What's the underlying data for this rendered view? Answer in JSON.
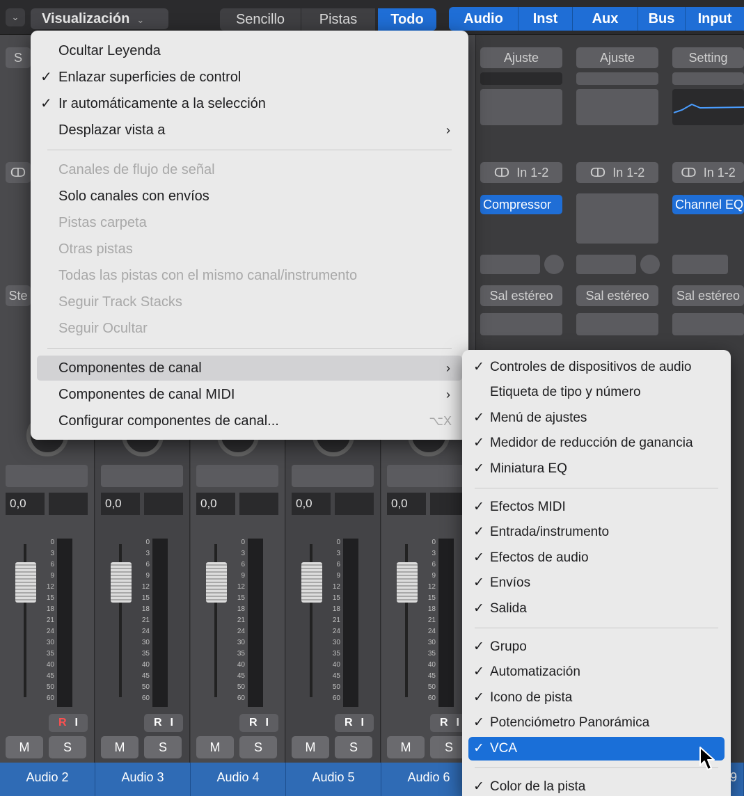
{
  "toolbar": {
    "collapse_icon": "chevron-down-icon",
    "view_menu": "Visualización",
    "filters": [
      "Sencillo",
      "Pistas",
      "Todo"
    ],
    "active_filter": "Todo",
    "types": [
      "Audio",
      "Inst",
      "Aux",
      "Bus",
      "Input"
    ]
  },
  "strip_fragments": {
    "settings_partial": "S",
    "output_partial": "Ste",
    "link_icon": "link-rings-icon"
  },
  "right_strips": [
    {
      "setting": "Ajuste",
      "input": "In 1-2",
      "plugin": "Compressor",
      "output": "Sal estéreo"
    },
    {
      "setting": "Ajuste",
      "input": "In 1-2",
      "plugin": "",
      "output": "Sal estéreo"
    },
    {
      "setting": "Setting",
      "input": "In 1-2",
      "plugin": "Channel EQ",
      "output": "Sal estéreo"
    }
  ],
  "channels": [
    {
      "name": "Audio 2",
      "volume": "0,0"
    },
    {
      "name": "Audio 3",
      "volume": "0,0"
    },
    {
      "name": "Audio 4",
      "volume": "0,0"
    },
    {
      "name": "Audio 5",
      "volume": "0,0"
    },
    {
      "name": "Audio 6",
      "volume": "0,0"
    }
  ],
  "channel_partial_right": "9",
  "meter_scale": [
    "0",
    "3",
    "6",
    "9",
    "12",
    "15",
    "18",
    "21",
    "24",
    "30",
    "35",
    "40",
    "45",
    "50",
    "60"
  ],
  "buttons": {
    "record": "R",
    "input_monitor": "I",
    "mute": "M",
    "solo": "S"
  },
  "menu": {
    "items": [
      {
        "label": "Ocultar Leyenda",
        "checked": false,
        "enabled": true
      },
      {
        "label": "Enlazar superficies de control",
        "checked": true,
        "enabled": true
      },
      {
        "label": "Ir automáticamente a la selección",
        "checked": true,
        "enabled": true
      },
      {
        "label": "Desplazar vista a",
        "checked": false,
        "enabled": true,
        "submenu": true
      }
    ],
    "filter_items": [
      {
        "label": "Canales de flujo de señal",
        "enabled": false
      },
      {
        "label": "Solo canales con envíos",
        "enabled": true
      },
      {
        "label": "Pistas carpeta",
        "enabled": false
      },
      {
        "label": "Otras pistas",
        "enabled": false
      },
      {
        "label": "Todas las pistas con el mismo canal/instrumento",
        "enabled": false
      },
      {
        "label": "Seguir Track Stacks",
        "enabled": false
      },
      {
        "label": "Seguir Ocultar",
        "enabled": false
      }
    ],
    "component_items": [
      {
        "label": "Componentes de canal",
        "submenu": true,
        "highlighted": true
      },
      {
        "label": "Componentes de canal MIDI",
        "submenu": true
      },
      {
        "label": "Configurar componentes de canal...",
        "shortcut": "⌥X"
      }
    ],
    "check_mark": "✓",
    "arrow": "›"
  },
  "submenu": {
    "group1": [
      {
        "label": "Controles de dispositivos de audio",
        "checked": true
      },
      {
        "label": "Etiqueta de tipo y número",
        "checked": false
      },
      {
        "label": "Menú de ajustes",
        "checked": true
      },
      {
        "label": "Medidor de reducción de ganancia",
        "checked": true
      },
      {
        "label": "Miniatura EQ",
        "checked": true
      }
    ],
    "group2": [
      {
        "label": "Efectos MIDI",
        "checked": true
      },
      {
        "label": "Entrada/instrumento",
        "checked": true
      },
      {
        "label": "Efectos de audio",
        "checked": true
      },
      {
        "label": "Envíos",
        "checked": true
      },
      {
        "label": "Salida",
        "checked": true
      }
    ],
    "group3": [
      {
        "label": "Grupo",
        "checked": true
      },
      {
        "label": "Automatización",
        "checked": true
      },
      {
        "label": "Icono de pista",
        "checked": true
      },
      {
        "label": "Potenciómetro Panorámica",
        "checked": true
      },
      {
        "label": "VCA",
        "checked": true,
        "selected": true
      }
    ],
    "group4": [
      {
        "label": "Color de la pista",
        "checked": true
      }
    ]
  },
  "colors": {
    "accent": "#1f6ed6",
    "menu_bg": "#eaeaea",
    "disabled_text": "#a8a8a8"
  }
}
